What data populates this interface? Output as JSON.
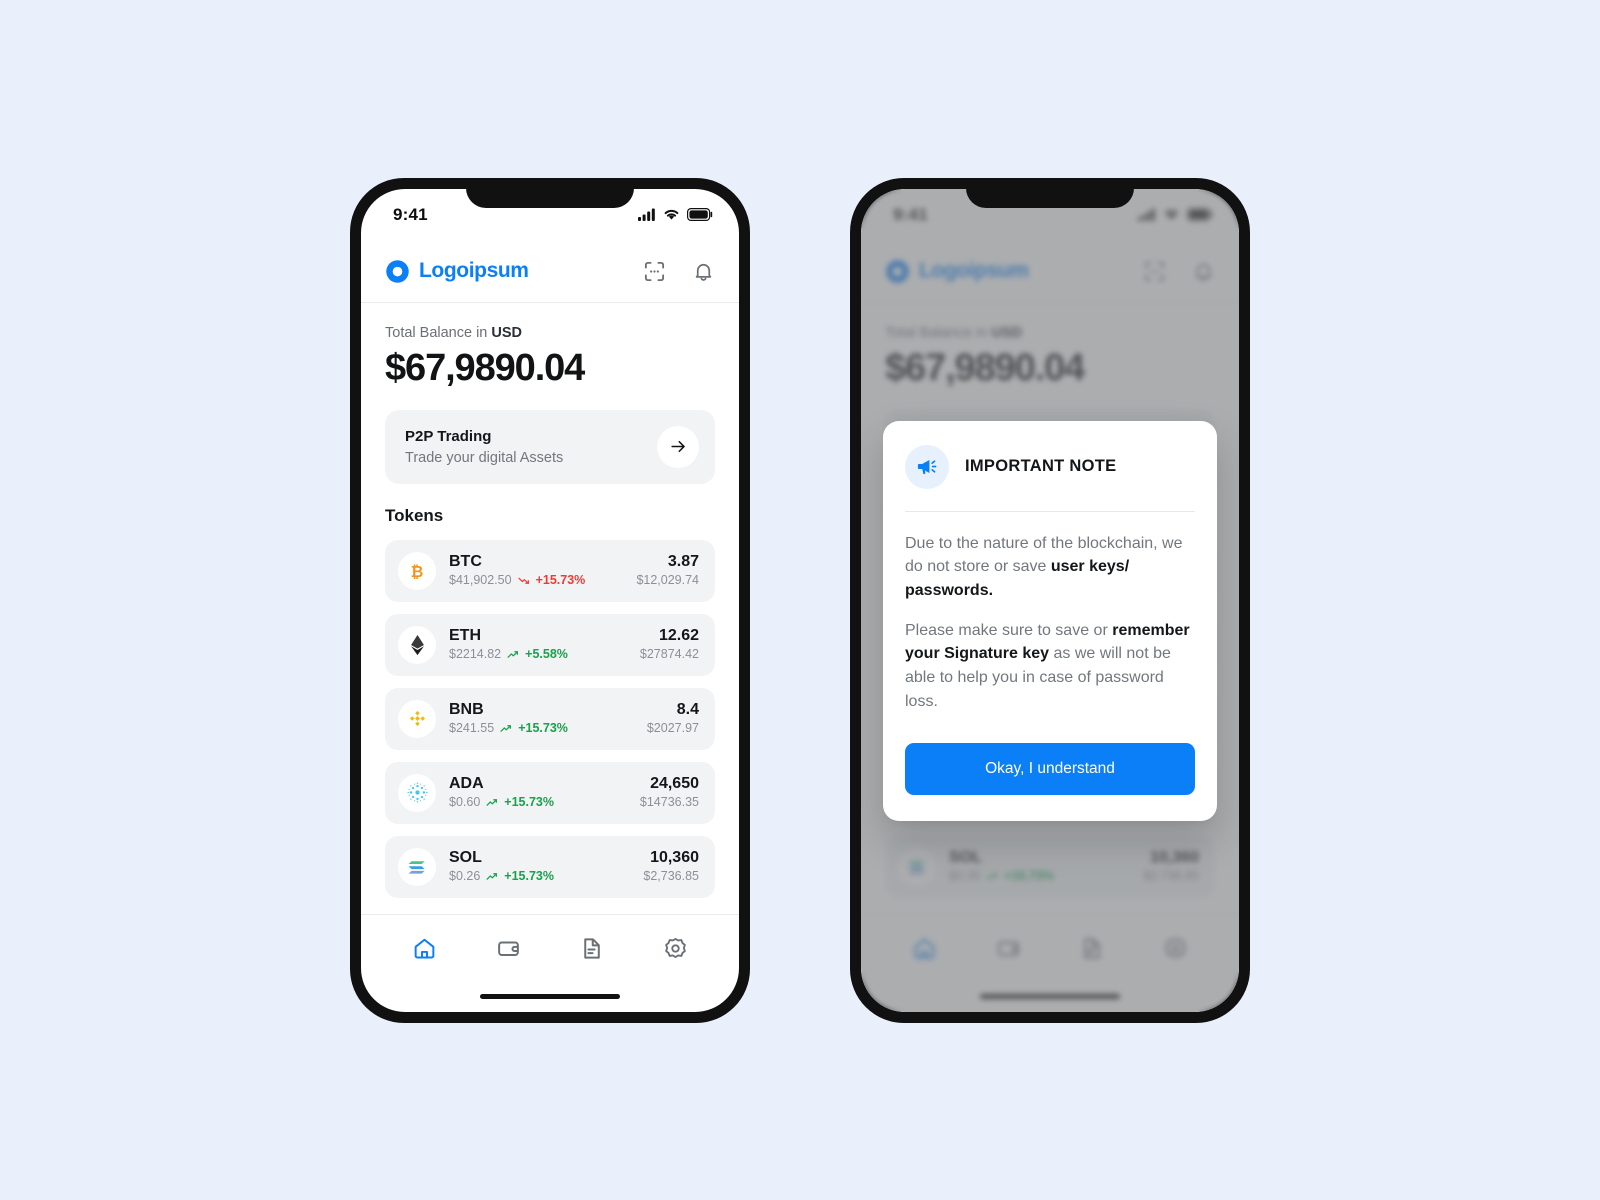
{
  "theme": {
    "page_background": "#e9effb",
    "brand_blue": "#0b7ff7",
    "positive_green": "#16a34a",
    "negative_red": "#ef3b36",
    "card_gray": "#f2f3f5"
  },
  "status_bar": {
    "time": "9:41",
    "icons": [
      "cellular-signal-icon",
      "wifi-icon",
      "battery-icon"
    ]
  },
  "app_header": {
    "logo_icon": "logoipsum-droplet-icon",
    "brand_name": "Logoipsum",
    "actions": [
      {
        "name": "scan-icon",
        "label": "Scan"
      },
      {
        "name": "bell-icon",
        "label": "Notifications"
      }
    ]
  },
  "balance": {
    "label_prefix": "Total Balance in ",
    "currency": "USD",
    "amount": "$67,9890.04"
  },
  "promo": {
    "title": "P2P Trading",
    "subtitle": "Trade your digital Assets",
    "arrow_icon": "arrow-right-icon"
  },
  "tokens_section": {
    "title": "Tokens",
    "items": [
      {
        "symbol": "BTC",
        "icon": "bitcoin-icon",
        "price": "$41,902.50",
        "change": "+15.73%",
        "direction": "down",
        "trend_icon": "trend-down-icon",
        "amount": "3.87",
        "value": "$12,029.74"
      },
      {
        "symbol": "ETH",
        "icon": "ethereum-icon",
        "price": "$2214.82",
        "change": "+5.58%",
        "direction": "up",
        "trend_icon": "trend-up-icon",
        "amount": "12.62",
        "value": "$27874.42"
      },
      {
        "symbol": "BNB",
        "icon": "binance-icon",
        "price": "$241.55",
        "change": "+15.73%",
        "direction": "up",
        "trend_icon": "trend-up-icon",
        "amount": "8.4",
        "value": "$2027.97"
      },
      {
        "symbol": "ADA",
        "icon": "cardano-icon",
        "price": "$0.60",
        "change": "+15.73%",
        "direction": "up",
        "trend_icon": "trend-up-icon",
        "amount": "24,650",
        "value": "$14736.35"
      },
      {
        "symbol": "SOL",
        "icon": "solana-icon",
        "price": "$0.26",
        "change": "+15.73%",
        "direction": "up",
        "trend_icon": "trend-up-icon",
        "amount": "10,360",
        "value": "$2,736.85"
      }
    ]
  },
  "tab_bar": {
    "items": [
      {
        "name": "tab-home",
        "icon": "home-icon",
        "active": true
      },
      {
        "name": "tab-wallet",
        "icon": "wallet-icon",
        "active": false
      },
      {
        "name": "tab-documents",
        "icon": "document-icon",
        "active": false
      },
      {
        "name": "tab-settings",
        "icon": "gear-icon",
        "active": false
      }
    ]
  },
  "modal": {
    "icon": "megaphone-icon",
    "title": "IMPORTANT NOTE",
    "paragraph1_a": "Due to the nature of the blockchain, we do not store or save ",
    "paragraph1_b": "user keys/ passwords.",
    "paragraph2_a": "Please make sure to save or ",
    "paragraph2_b": "remember your Signature key",
    "paragraph2_c": " as we will not be able to help you in case of password loss.",
    "button_label": "Okay, I understand"
  }
}
